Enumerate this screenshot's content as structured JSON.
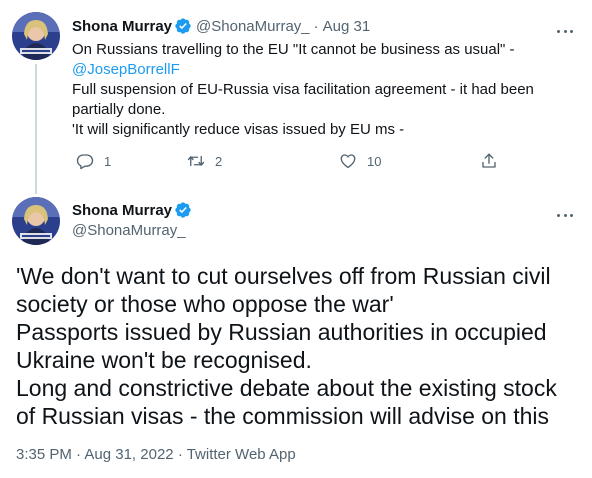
{
  "colors": {
    "accent": "#1d9bf0",
    "secondary_text": "#536471",
    "primary_text": "#0f1419",
    "thread_line": "#cfd9de"
  },
  "tweet1": {
    "name": "Shona Murray",
    "handle": "@ShonaMurray_",
    "separator": "·",
    "date": "Aug 31",
    "body": {
      "line1": "On Russians travelling to the EU \"It cannot be business as usual\" -",
      "mention": "@JosepBorrellF",
      "line3": "Full suspension of EU-Russia visa facilitation agreement - it had been partially done.",
      "line4": "'It will significantly reduce visas issued by EU ms -"
    },
    "actions": {
      "reply_icon": "reply-icon",
      "reply_count": "1",
      "retweet_icon": "retweet-icon",
      "retweet_count": "2",
      "like_icon": "heart-icon",
      "like_count": "10",
      "share_icon": "share-icon"
    }
  },
  "tweet2": {
    "name": "Shona Murray",
    "handle": "@ShonaMurray_",
    "body": {
      "line1": "'We don't want to cut ourselves off from Russian civil society or those who oppose the war'",
      "line2": "Passports issued by Russian authorities in occupied Ukraine won't be recognised.",
      "line3": "Long and constrictive debate about the existing stock of Russian visas - the commission will advise on this"
    },
    "meta": {
      "time": "3:35 PM",
      "sep1": "·",
      "date": "Aug 31, 2022",
      "sep2": "·",
      "source": "Twitter Web App"
    }
  }
}
